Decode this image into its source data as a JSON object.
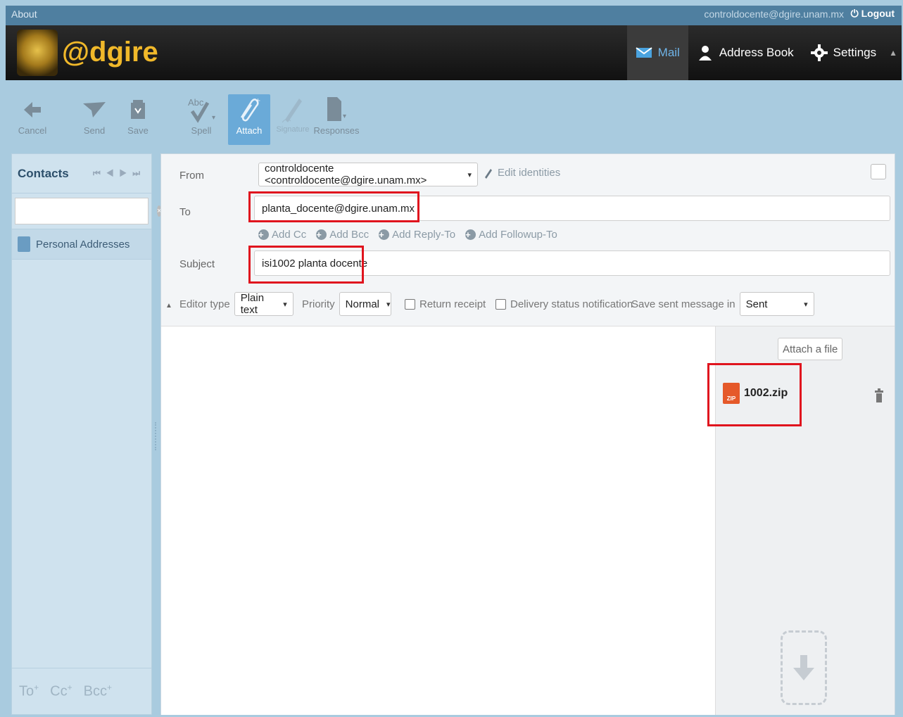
{
  "topbar": {
    "about": "About",
    "user": "controldocente@dgire.unam.mx",
    "logout": "Logout"
  },
  "header": {
    "logo_text": "@dgire",
    "tasks": {
      "mail": "Mail",
      "addressbook": "Address Book",
      "settings": "Settings"
    }
  },
  "toolbar": {
    "cancel": "Cancel",
    "send": "Send",
    "save": "Save",
    "spell": "Spell",
    "attach": "Attach",
    "signature": "Signature",
    "responses": "Responses"
  },
  "contacts": {
    "title": "Contacts",
    "search_placeholder": "",
    "group": "Personal Addresses",
    "footer": {
      "to": "To",
      "cc": "Cc",
      "bcc": "Bcc"
    }
  },
  "compose": {
    "from_label": "From",
    "from_value": "controldocente <controldocente@dgire.unam.mx>",
    "edit_identities": "Edit identities",
    "to_label": "To",
    "to_value": "planta_docente@dgire.unam.mx",
    "add_links": {
      "cc": "Add Cc",
      "bcc": "Add Bcc",
      "reply_to": "Add Reply-To",
      "followup_to": "Add Followup-To"
    },
    "subject_label": "Subject",
    "subject_value": "isi1002 planta docente",
    "options": {
      "editor_type_label": "Editor type",
      "editor_type_value": "Plain text",
      "priority_label": "Priority",
      "priority_value": "Normal",
      "return_receipt": "Return receipt",
      "dsn": "Delivery status notification",
      "save_sent_label": "Save sent message in",
      "save_sent_value": "Sent"
    },
    "body": ""
  },
  "attachments": {
    "attach_button": "Attach a file",
    "files": [
      {
        "name": "1002.zip",
        "type_badge": "ZIP"
      }
    ]
  },
  "colors": {
    "highlight": "#e0141e",
    "accent": "#6aaad8",
    "brand": "#f0b82a"
  }
}
